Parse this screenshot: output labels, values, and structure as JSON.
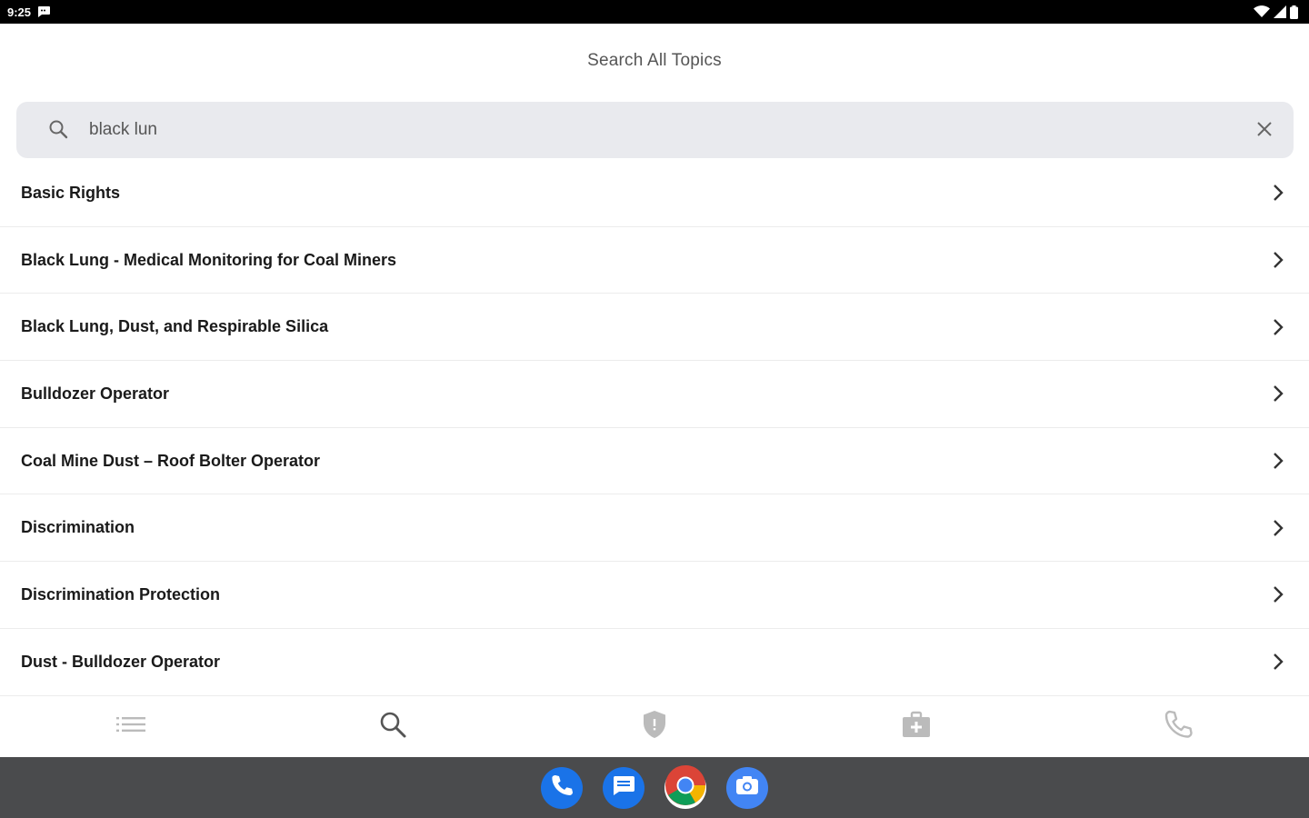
{
  "status_bar": {
    "time": "9:25"
  },
  "header": {
    "title": "Search All Topics"
  },
  "search": {
    "value": "black lun",
    "placeholder": ""
  },
  "results": [
    {
      "label": "Basic Rights"
    },
    {
      "label": "Black Lung - Medical Monitoring for Coal Miners"
    },
    {
      "label": "Black Lung, Dust, and Respirable Silica"
    },
    {
      "label": "Bulldozer Operator"
    },
    {
      "label": "Coal Mine Dust – Roof Bolter Operator"
    },
    {
      "label": "Discrimination"
    },
    {
      "label": "Discrimination Protection"
    },
    {
      "label": "Dust - Bulldozer Operator"
    }
  ],
  "tabs": [
    {
      "icon": "list-icon",
      "active": false
    },
    {
      "icon": "search-icon",
      "active": true
    },
    {
      "icon": "shield-icon",
      "active": false
    },
    {
      "icon": "medical-kit-icon",
      "active": false
    },
    {
      "icon": "phone-icon",
      "active": false
    }
  ],
  "dock": [
    {
      "icon": "phone-app-icon",
      "color": "#1a73e8"
    },
    {
      "icon": "messages-app-icon",
      "color": "#1a73e8"
    },
    {
      "icon": "chrome-app-icon",
      "color": "#ffffff"
    },
    {
      "icon": "camera-app-icon",
      "color": "#4285f4"
    }
  ],
  "colors": {
    "status_bar": "#000000",
    "search_bg": "#e9eaee",
    "nav_bar": "#4a4b4d",
    "text_primary": "#1a1a1a",
    "text_secondary": "#555555",
    "icon_inactive": "#bbbbbb"
  }
}
